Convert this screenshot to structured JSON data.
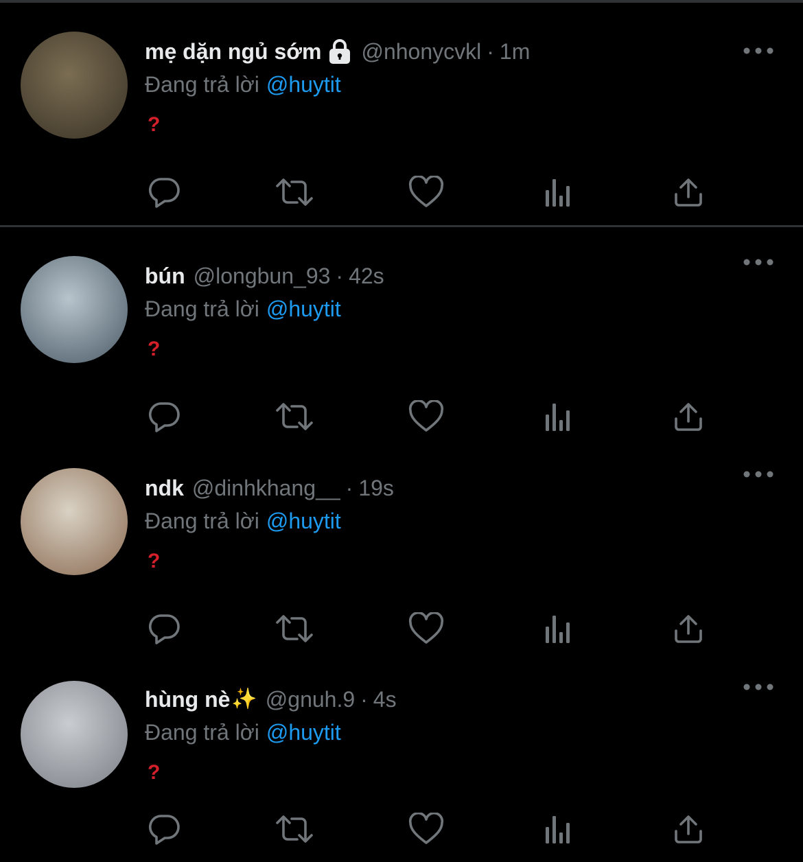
{
  "tweets": [
    {
      "display_name": "mẹ dặn ngủ sớm",
      "protected": true,
      "handle": "@nhonycvkl",
      "separator": "·",
      "time": "1m",
      "reply_prefix": "Đang trả lời",
      "reply_to": "@huytit",
      "body": "?",
      "avatar_colors": [
        "#7a6d52",
        "#3a3226"
      ]
    },
    {
      "display_name": "bún",
      "protected": false,
      "handle": "@longbun_93",
      "separator": "·",
      "time": "42s",
      "reply_prefix": "Đang trả lời",
      "reply_to": "@huytit",
      "body": "?",
      "avatar_colors": [
        "#b8c4cc",
        "#4a5a66"
      ]
    },
    {
      "display_name": "ndk",
      "protected": false,
      "handle": "@dinhkhang__",
      "separator": "·",
      "time": "19s",
      "reply_prefix": "Đang trả lời",
      "reply_to": "@huytit",
      "body": "?",
      "avatar_colors": [
        "#d9d2c4",
        "#8a6a52"
      ]
    },
    {
      "display_name": "hùng nè",
      "emoji": "✨",
      "protected": false,
      "handle": "@gnuh.9",
      "separator": "·",
      "time": "4s",
      "reply_prefix": "Đang trả lời",
      "reply_to": "@huytit",
      "body": "?",
      "avatar_colors": [
        "#c9ccd0",
        "#7a7f86"
      ]
    }
  ],
  "icons": {
    "more": "more-horizontal-icon",
    "reply": "reply-icon",
    "retweet": "retweet-icon",
    "like": "like-icon",
    "views": "views-icon",
    "share": "share-icon",
    "lock": "lock-icon"
  },
  "colors": {
    "background": "#000000",
    "primary_text": "#e7e9ea",
    "secondary_text": "#71767b",
    "link": "#1d9bf0",
    "divider": "#2f3336",
    "question_mark": "#d4202b"
  }
}
